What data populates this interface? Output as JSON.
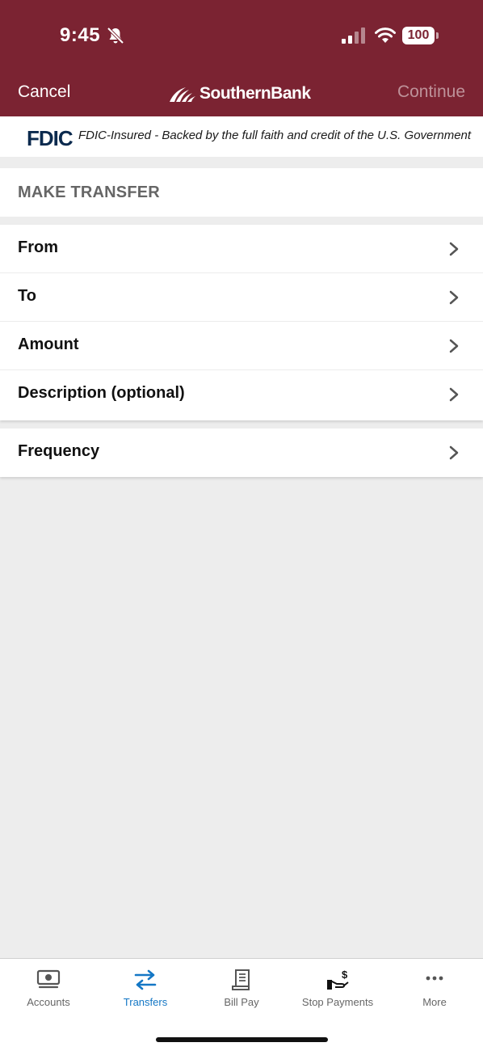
{
  "colors": {
    "brand": "#7b2332",
    "accent": "#1477c5",
    "fdic": "#0b2a4e"
  },
  "status_bar": {
    "time": "9:45",
    "battery": "100"
  },
  "nav": {
    "cancel_label": "Cancel",
    "brand_name": "SouthernBank",
    "continue_label": "Continue"
  },
  "fdic": {
    "logo_text": "FDIC",
    "message": "FDIC-Insured - Backed by the full faith and credit of the U.S. Government"
  },
  "section": {
    "title": "MAKE TRANSFER"
  },
  "form": {
    "rows": [
      {
        "label": "From"
      },
      {
        "label": "To"
      },
      {
        "label": "Amount"
      },
      {
        "label": "Description (optional)"
      }
    ],
    "frequency_label": "Frequency"
  },
  "tabbar": {
    "tabs": [
      {
        "label": "Accounts",
        "icon": "accounts-icon"
      },
      {
        "label": "Transfers",
        "icon": "transfers-icon",
        "active": true
      },
      {
        "label": "Bill Pay",
        "icon": "bill-pay-icon"
      },
      {
        "label": "Stop Payments",
        "icon": "stop-payments-icon"
      },
      {
        "label": "More",
        "icon": "more-icon"
      }
    ]
  }
}
